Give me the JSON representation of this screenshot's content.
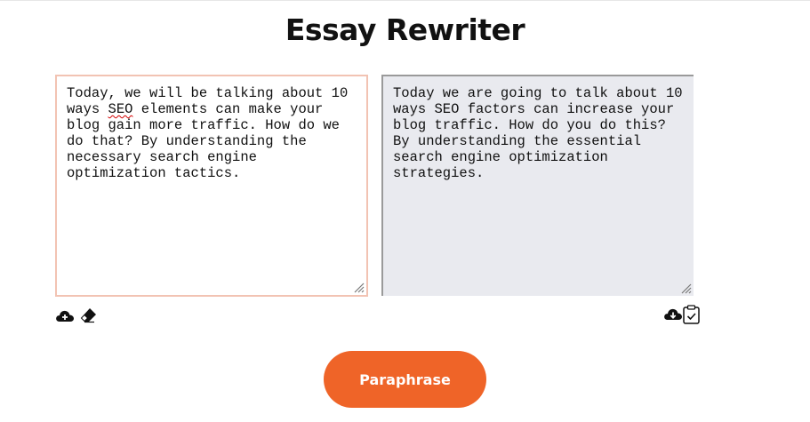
{
  "page": {
    "title": "Essay Rewriter"
  },
  "input": {
    "text_before": "Today, we will be talking about 10 ways ",
    "misspelled": "SEO",
    "text_after": " elements can make your blog gain more traffic. How do we do that? By understanding the necessary search engine optimization tactics."
  },
  "output": {
    "text": "Today we are going to talk about 10 ways SEO factors can increase your blog traffic. How do you do this? By understanding the essential search engine optimization strategies."
  },
  "actions": {
    "paraphrase_label": "Paraphrase"
  },
  "icons": {
    "upload": "cloud-upload-icon",
    "clear": "eraser-icon",
    "download": "cloud-download-icon",
    "copy": "clipboard-check-icon"
  },
  "colors": {
    "accent": "#ef6428",
    "input_border": "#f2c3b3",
    "output_bg": "#e9eaef"
  }
}
